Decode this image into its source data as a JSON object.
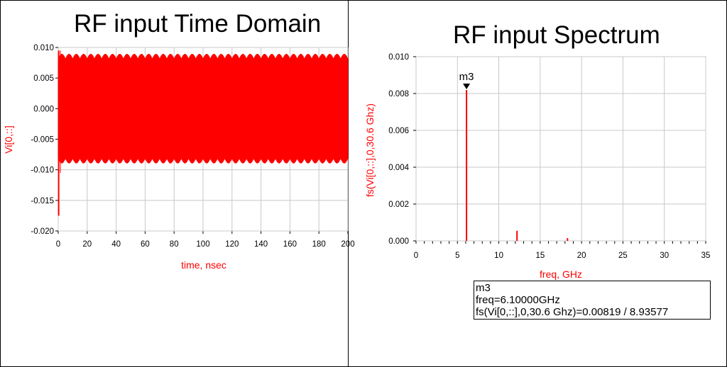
{
  "chart_data": [
    {
      "type": "line",
      "title": "RF input Time Domain",
      "xlabel": "time, nsec",
      "ylabel": "Vi[0,::]",
      "xlim": [
        0,
        200
      ],
      "ylim": [
        -0.02,
        0.01
      ],
      "xticks": [
        "0",
        "20",
        "40",
        "60",
        "80",
        "100",
        "120",
        "140",
        "160",
        "180",
        "200"
      ],
      "yticks": [
        "0.010",
        "0.005",
        "0.000",
        "-0.005",
        "-0.010",
        "-0.015",
        "-0.020"
      ],
      "grid": true,
      "series": [
        {
          "envelope_upper_range": [
            0.0081,
            0.0089
          ],
          "envelope_lower_range": [
            -0.0089,
            -0.0081
          ],
          "startup_min": -0.0175,
          "startup_peak": 0.0095,
          "color": "#ff0000"
        }
      ]
    },
    {
      "type": "bar",
      "title": "RF input Spectrum",
      "xlabel": "freq, GHz",
      "ylabel": "fs(Vi[0,::],0,30.6 Ghz)",
      "xlim": [
        0,
        35
      ],
      "ylim": [
        0,
        0.01
      ],
      "xticks": [
        "0",
        "5",
        "10",
        "15",
        "20",
        "25",
        "30",
        "35"
      ],
      "yticks": [
        "0.010",
        "0.008",
        "0.006",
        "0.004",
        "0.002",
        "0.000"
      ],
      "grid": true,
      "series": [
        {
          "x": [
            6.1,
            12.2,
            18.3
          ],
          "values": [
            0.00819,
            0.00055,
            0.00015
          ],
          "color": "#ff0000"
        }
      ],
      "marker": {
        "name": "m3",
        "x": 6.1,
        "y": 0.00819,
        "lines": [
          "m3",
          "freq=6.10000GHz",
          "fs(Vi[0,::],0,30.6 Ghz)=0.00819 / 8.93577"
        ]
      }
    }
  ]
}
